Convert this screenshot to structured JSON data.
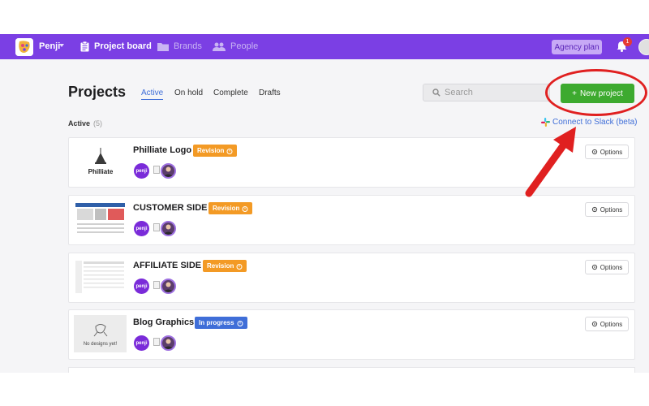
{
  "header": {
    "brand": "Penji",
    "nav": [
      {
        "label": "Project board",
        "icon": "clipboard-icon"
      },
      {
        "label": "Brands",
        "icon": "folder-icon"
      },
      {
        "label": "People",
        "icon": "people-icon"
      }
    ],
    "agency_plan": "Agency plan",
    "notification_count": "1"
  },
  "page": {
    "title": "Projects",
    "tabs": [
      "Active",
      "On hold",
      "Complete",
      "Drafts"
    ],
    "search_placeholder": "Search",
    "new_project_label": "New project",
    "new_project_plus": "+",
    "section_label": "Active",
    "section_count": "(5)",
    "slack_link": "Connect to Slack (beta)"
  },
  "projects": [
    {
      "name": "Philliate Logo",
      "status": "Revision",
      "thumb_text": "Philliate",
      "options": "Options",
      "avatar": "penji"
    },
    {
      "name": "CUSTOMER SIDE",
      "status": "Revision",
      "thumb_text": "",
      "options": "Options",
      "avatar": "penji"
    },
    {
      "name": "AFFILIATE SIDE",
      "status": "Revision",
      "thumb_text": "",
      "options": "Options",
      "avatar": "penji"
    },
    {
      "name": "Blog Graphics",
      "status": "In progress",
      "thumb_text": "No designs yet!",
      "options": "Options",
      "avatar": "penji"
    }
  ],
  "colors": {
    "nav_purple": "#7b3fe4",
    "new_project_green": "#3daa2f",
    "revision_orange": "#f39a25",
    "in_progress_blue": "#3f6ed8",
    "annotation_red": "#e02020"
  }
}
